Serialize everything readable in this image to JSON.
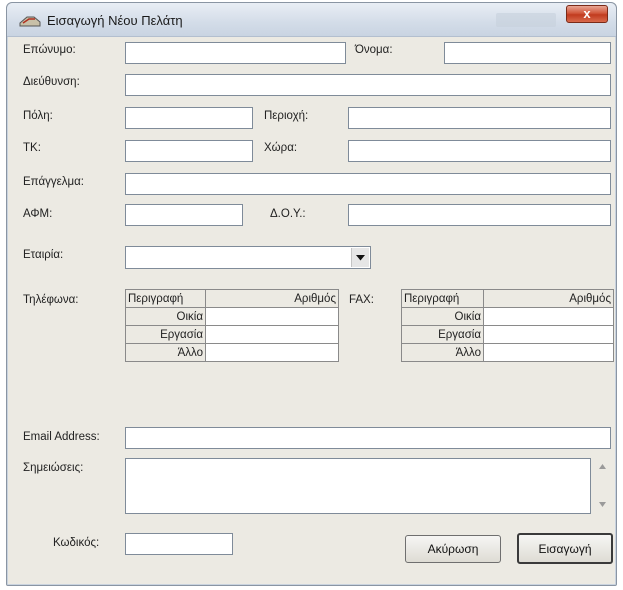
{
  "window": {
    "title": "Εισαγωγή Νέου Πελάτη",
    "close_label": "x"
  },
  "form": {
    "surname_label": "Επώνυμο:",
    "name_label": "Όνομα:",
    "address_label": "Διεύθυνση:",
    "city_label": "Πόλη:",
    "area_label": "Περιοχή:",
    "zip_label": "ΤΚ:",
    "country_label": "Χώρα:",
    "profession_label": "Επάγγελμα:",
    "afm_label": "ΑΦΜ:",
    "doy_label": "Δ.Ο.Υ.:",
    "company_label": "Εταιρία:",
    "phones_label": "Τηλέφωνα:",
    "fax_label": "FAX:",
    "email_label": "Email Address:",
    "notes_label": "Σημειώσεις:",
    "code_label": "Κωδικός:"
  },
  "phones": {
    "headers": [
      "Περιγραφή",
      "Αριθμός"
    ],
    "rows": [
      "Οικία",
      "Εργασία",
      "Άλλο"
    ]
  },
  "fax": {
    "headers": [
      "Περιγραφή",
      "Αριθμός"
    ],
    "rows": [
      "Οικία",
      "Εργασία",
      "Άλλο"
    ]
  },
  "buttons": {
    "cancel": "Ακύρωση",
    "insert": "Εισαγωγή"
  }
}
